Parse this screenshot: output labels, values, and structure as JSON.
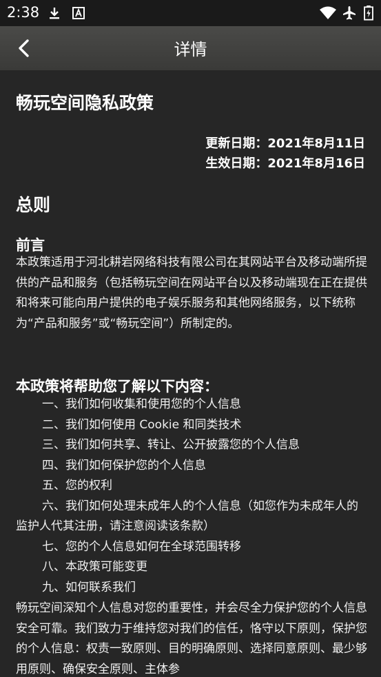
{
  "status_bar": {
    "time": "2:38",
    "icons": [
      "download-icon",
      "font-icon",
      "wifi-icon",
      "airplane-icon",
      "battery-icon"
    ]
  },
  "app_bar": {
    "title": "详情",
    "back_icon": "chevron-left-icon"
  },
  "document": {
    "title": "畅玩空间隐私政策",
    "updated": "更新日期：2021年8月11日",
    "effective": "生效日期：2021年8月16日",
    "section_title": "总则",
    "preface_title": "前言",
    "preface_body": "本政策适用于河北耕岩网络科技有限公司在其网站平台及移动端所提供的产品和服务（包括畅玩空间在网站平台以及移动端现在正在提供和将来可能向用户提供的电子娱乐服务和其他网络服务，以下统称为“产品和服务”或“畅玩空间”）所制定的。",
    "toc_title": "本政策将帮助您了解以下内容：",
    "toc_items": [
      "一、我们如何收集和使用您的个人信息",
      "二、我们如何使用 Cookie 和同类技术",
      "三、我们如何共享、转让、公开披露您的个人信息",
      "四、我们如何保护您的个人信息",
      "五、您的权利",
      "六、我们如何处理未成年人的个人信息（如您作为未成年人的监护人代其注册，请注意阅读该条款）",
      "七、您的个人信息如何在全球范围转移",
      "八、本政策可能变更",
      "九、如何联系我们"
    ],
    "closing_body": "畅玩空间深知个人信息对您的重要性，并会尽全力保护您的个人信息安全可靠。我们致力于维持您对我们的信任，恪守以下原则，保护您的个人信息：权责一致原则、目的明确原则、选择同意原则、最少够用原则、确保安全原则、主体参"
  }
}
